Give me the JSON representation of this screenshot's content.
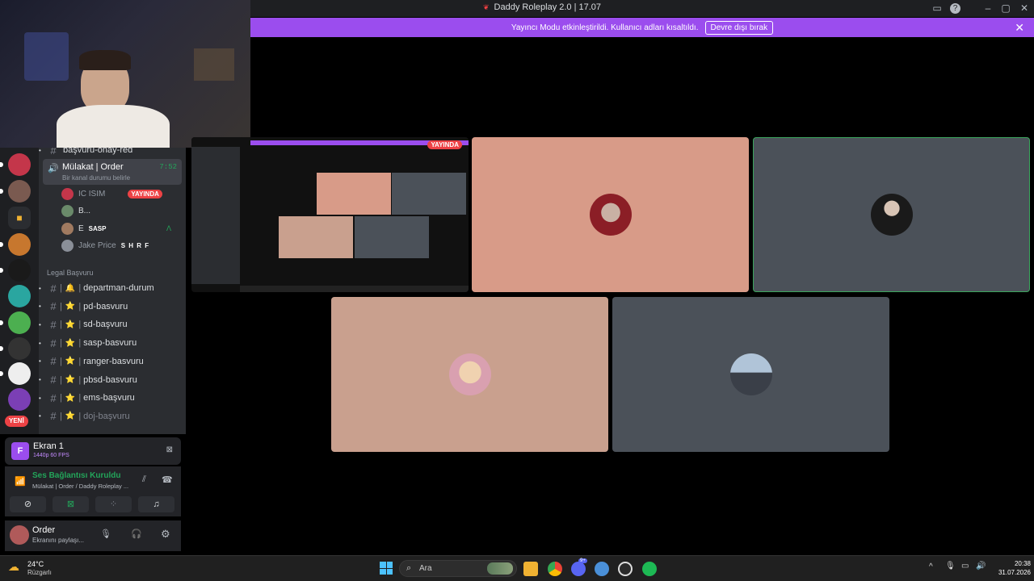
{
  "window": {
    "title": "Daddy Roleplay 2.0 | 17.07"
  },
  "banner": {
    "text": "Yayıncı Modu etkinleştirildi. Kullanıcı adları kısaltıldı.",
    "button": "Devre dışı bırak"
  },
  "channels": {
    "top_partial": "başvuru-onay-red",
    "voice_channel": {
      "name": "Mülakat | Order",
      "time": "7:52",
      "status_placeholder": "Bir kanal durumu belirle"
    },
    "voice_users": [
      {
        "name": "IC ISIM",
        "badge": "YAYINDA"
      },
      {
        "name": "B..."
      },
      {
        "name": "E",
        "tag": "SASP"
      },
      {
        "name": "Jake Price",
        "tag": "S H R F"
      }
    ],
    "category": "Legal Başvuru",
    "text_channels": [
      {
        "emoji": "🔔",
        "name": "departman-durum"
      },
      {
        "emoji": "⭐",
        "name": "pd-basvuru"
      },
      {
        "emoji": "⭐",
        "name": "sd-başvuru"
      },
      {
        "emoji": "⭐",
        "name": "sasp-basvuru"
      },
      {
        "emoji": "⭐",
        "name": "ranger-basvuru"
      },
      {
        "emoji": "⭐",
        "name": "pbsd-basvuru"
      },
      {
        "emoji": "⭐",
        "name": "ems-başvuru"
      },
      {
        "emoji": "⭐",
        "name": "doj-başvuru"
      }
    ]
  },
  "rail": {
    "new_badge": "YENİ"
  },
  "screen_share": {
    "title": "Ekran 1",
    "quality": "1440p 60 FPS"
  },
  "voice_status": {
    "title": "Ses Bağlantısı Kuruldu",
    "subtitle": "Mülakat | Order / Daddy Roleplay ..."
  },
  "user": {
    "name": "Order",
    "status": "Ekranını paylaşı..."
  },
  "stream_preview": {
    "badge": "YAYINDA"
  },
  "taskbar": {
    "weather_temp": "24°C",
    "weather_label": "Rüzgarlı",
    "search_placeholder": "Ara",
    "discord_badge": "9+",
    "time": "20:38",
    "date": "31.07.2026"
  },
  "colors": {
    "accent": "#9b4dee",
    "live": "#ed4245",
    "online": "#23a55a",
    "tile_peach": "#d89b88",
    "tile_gray": "#4b5159"
  }
}
